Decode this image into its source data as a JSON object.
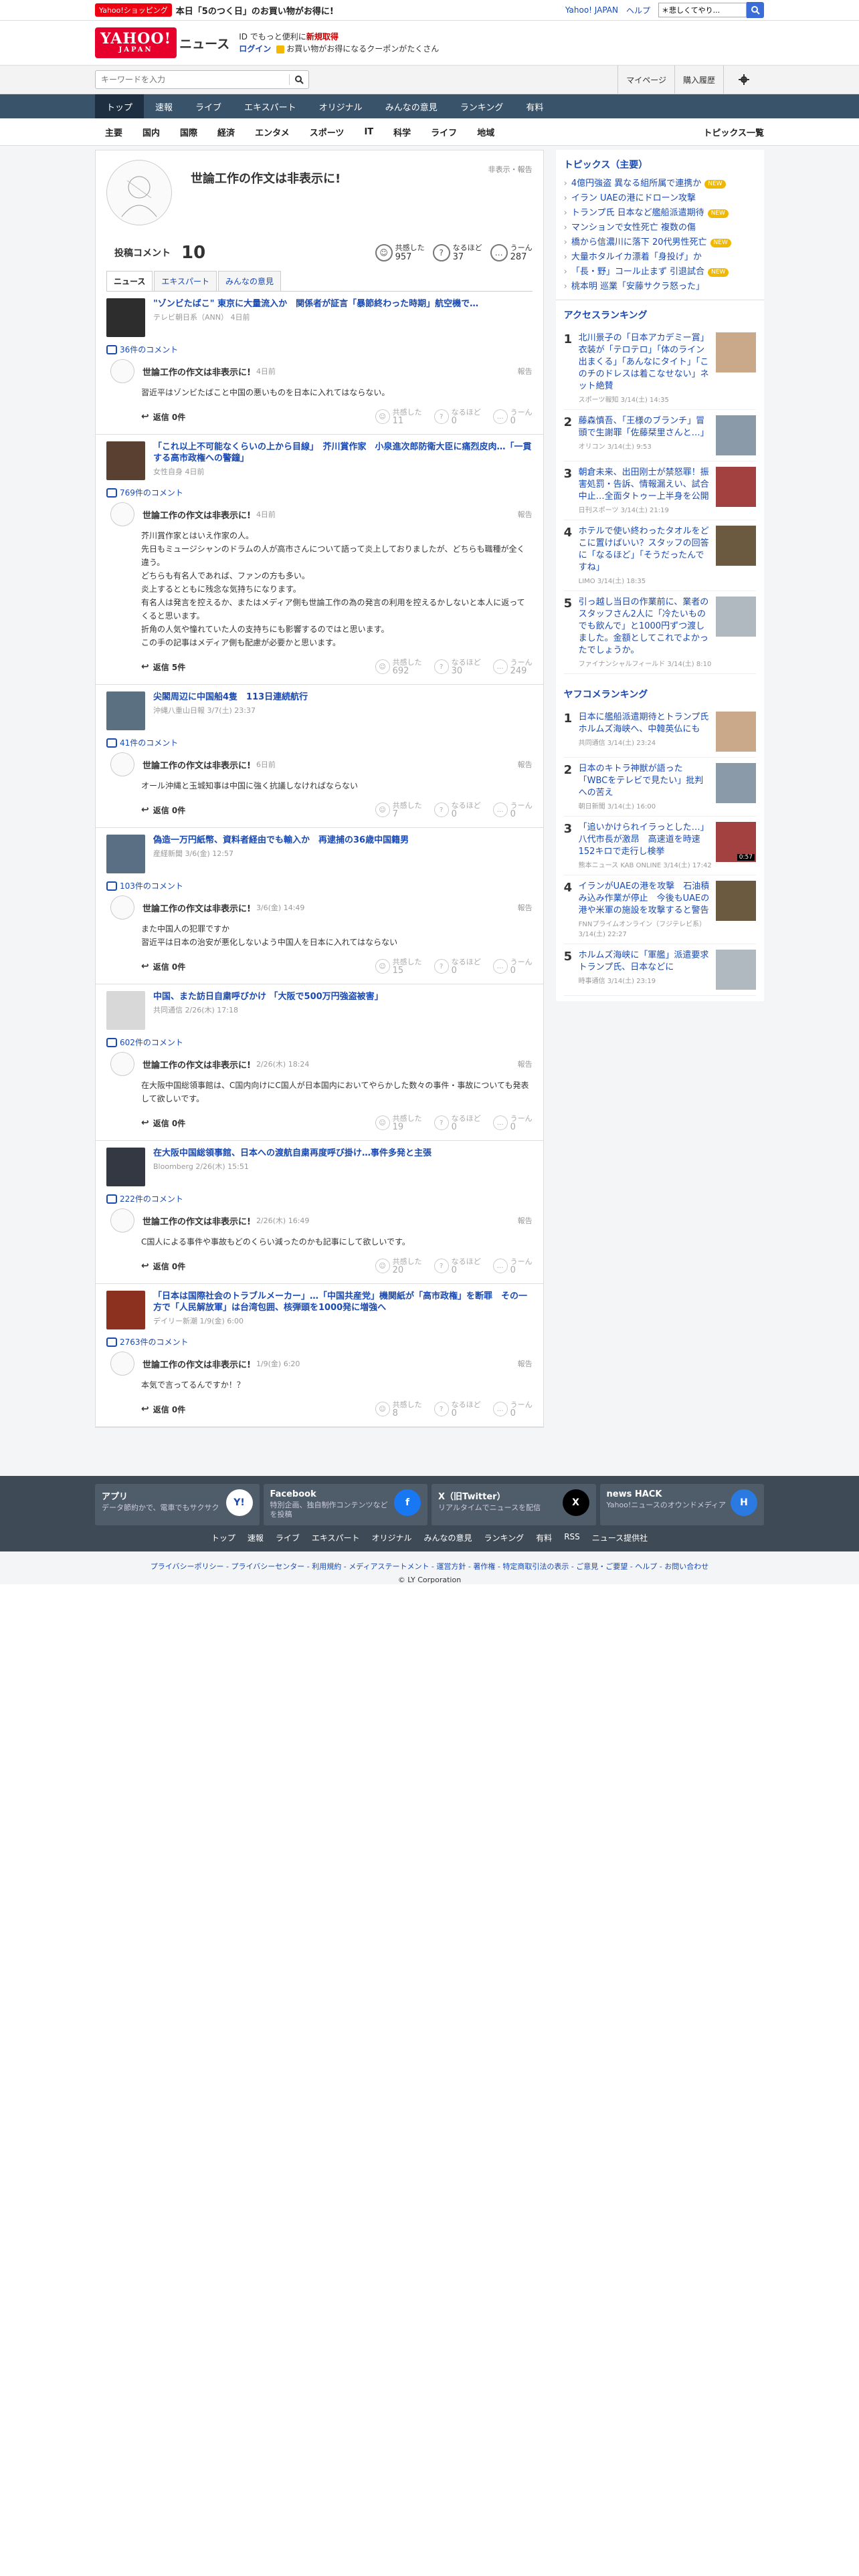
{
  "topstrip": {
    "shop_badge": "Yahoo!ショッピング",
    "promo": "本日「5のつく日」のお買い物がお得に!",
    "links": [
      "Yahoo! JAPAN",
      "ヘルプ"
    ],
    "websearch_placeholder": "ウェブ検索",
    "websearch_value": "＊悲しくてやり..."
  },
  "header": {
    "logo_main": "YAHOO!",
    "logo_sub": "JAPAN",
    "section": "ニュース",
    "promo_line1_a": "ID でもっと便利に",
    "promo_line1_b": "新規取得",
    "login": "ログイン",
    "promo_line2": "お買い物がお得になるクーポンがたくさん"
  },
  "search": {
    "placeholder": "キーワードを入力",
    "links": [
      "マイページ",
      "購入履歴"
    ]
  },
  "mainnav": [
    "トップ",
    "速報",
    "ライブ",
    "エキスパート",
    "オリジナル",
    "みんなの意見",
    "ランキング",
    "有料"
  ],
  "subnav": [
    "主要",
    "国内",
    "国際",
    "経済",
    "エンタメ",
    "スポーツ",
    "IT",
    "科学",
    "ライフ",
    "地域"
  ],
  "subnav_right": "トピックス一覧",
  "profile": {
    "name": "世論工作の作文は非表示に!",
    "report": "非表示・報告",
    "comments_label": "投稿コメント",
    "comments_count": "10",
    "reactions": [
      {
        "label": "共感した",
        "value": "957",
        "icon": "smile-icon"
      },
      {
        "label": "なるほど",
        "value": "37",
        "icon": "question-icon"
      },
      {
        "label": "うーん",
        "value": "287",
        "icon": "hmm-icon"
      }
    ]
  },
  "tabs": [
    "ニュース",
    "エキスパート",
    "みんなの意見"
  ],
  "common": {
    "reply": "返信 0件",
    "report": "報告",
    "vote_labels": [
      "共感した",
      "なるほど",
      "うーん"
    ]
  },
  "comments": [
    {
      "article_title": "\"ゾンビたばこ\" 東京に大量流入か　関係者が証言「暴節終わった時期」航空機で…",
      "article_source": "テレビ朝日系（ANN） 4日前",
      "comment_count": "36件のコメント",
      "name": "世論工作の作文は非表示に!",
      "date": "4日前",
      "text": "習近平はゾンビたばこと中国の悪いものを日本に入れてはならない。",
      "reply": "返信 0件",
      "votes": [
        "11",
        "0",
        "0"
      ]
    },
    {
      "article_title": "「これ以上不可能なくらいの上から目線」　芥川賞作家　小泉進次郎防衛大臣に痛烈皮肉…「一貫する高市政権への警鐘」",
      "article_source": "女性自身 4日前",
      "comment_count": "769件のコメント",
      "name": "世論工作の作文は非表示に!",
      "date": "4日前",
      "text": "芥川賞作家とはいえ作家の人。\n先日もミュージシャンのドラムの人が高市さんについて語って炎上しておりましたが、どちらも職種が全く違う。\nどちらも有名人であれば、ファンの方も多い。\n炎上するとともに残念な気持ちになります。\n有名人は発言を控えるか、またはメディア側も世論工作の為の発言の利用を控えるかしないと本人に返ってくると思います。\n折角の人気や憧れていた人の支持ちにも影響するのではと思います。\nこの手の記事はメディア側も配慮が必要かと思います。",
      "reply": "返信 5件",
      "votes": [
        "692",
        "30",
        "249"
      ]
    },
    {
      "article_title": "尖閣周辺に中国船4隻　113日連続航行",
      "article_source": "沖縄八重山日報 3/7(土) 23:37",
      "comment_count": "41件のコメント",
      "name": "世論工作の作文は非表示に!",
      "date": "6日前",
      "text": "オール沖縄と玉城知事は中国に強く抗議しなければならない",
      "reply": "返信 0件",
      "votes": [
        "7",
        "0",
        "0"
      ]
    },
    {
      "article_title": "偽造一万円紙幣、資料者経由でも輸入か　再逮捕の36歳中国籍男",
      "article_source": "産経新聞 3/6(金) 12:57",
      "comment_count": "103件のコメント",
      "name": "世論工作の作文は非表示に!",
      "date": "3/6(金) 14:49",
      "text": "また中国人の犯罪ですか\n習近平は日本の治安が悪化しないよう中国人を日本に入れてはならない",
      "reply": "返信 0件",
      "votes": [
        "15",
        "0",
        "0"
      ]
    },
    {
      "article_title": "中国、また訪日自粛呼びかけ 「大阪で500万円強盗被害」",
      "article_source": "共同通信 2/26(木) 17:18",
      "comment_count": "602件のコメント",
      "name": "世論工作の作文は非表示に!",
      "date": "2/26(木) 18:24",
      "text": "在大阪中国総領事館は、C国内向けにC国人が日本国内においてやらかした数々の事件・事故についても発表して欲しいです。",
      "reply": "返信 0件",
      "votes": [
        "19",
        "0",
        "0"
      ]
    },
    {
      "article_title": "在大阪中国総領事館、日本への渡航自粛再度呼び掛け…事件多発と主張",
      "article_source": "Bloomberg 2/26(木) 15:51",
      "comment_count": "222件のコメント",
      "name": "世論工作の作文は非表示に!",
      "date": "2/26(木) 16:49",
      "text": "C国人による事件や事故もどのくらい減ったのかも記事にして欲しいです。",
      "reply": "返信 0件",
      "votes": [
        "20",
        "0",
        "0"
      ]
    },
    {
      "article_title": "「日本は国際社会のトラブルメーカー」…「中国共産党」機関紙が「高市政権」を断罪　その一方で「人民解放軍」は台湾包囲、核弾頭を1000発に増強へ",
      "article_source": "デイリー新潮 1/9(金) 6:00",
      "comment_count": "2763件のコメント",
      "name": "世論工作の作文は非表示に!",
      "date": "1/9(金) 6:20",
      "text": "本気で言ってるんですか！？",
      "reply": "返信 0件",
      "votes": [
        "8",
        "0",
        "0"
      ]
    }
  ],
  "sidebar": {
    "topics_title": "トピックス（主要）",
    "topics": [
      {
        "text": "4億円強盗 異なる組所属で連携か",
        "new": true
      },
      {
        "text": "イラン UAEの港にドローン攻撃",
        "new": false
      },
      {
        "text": "トランプ氏 日本など艦船派遣期待",
        "new": true
      },
      {
        "text": "マンションで女性死亡 複数の傷",
        "new": false
      },
      {
        "text": "橋から信濃川に落下 20代男性死亡",
        "new": true
      },
      {
        "text": "大量ホタルイカ漂着「身投げ」か",
        "new": false
      },
      {
        "text": "「長・野」コール止まず 引退試合",
        "new": true
      },
      {
        "text": "桃本明 巡業「安藤サクラ怒った」",
        "new": false
      }
    ],
    "new_label": "NEW",
    "access_title": "アクセスランキング",
    "access": [
      {
        "n": "1",
        "title": "北川景子の「日本アカデミー賞」衣装が「テロテロ」「体のライン出まくる」「あんなにタイト」「このチのドレスは着こなせない」ネット絶賛",
        "src": "スポーツ報知 3/14(土) 14:35",
        "video": ""
      },
      {
        "n": "2",
        "title": "藤森慎吾、「王様のブランチ」冒頭で生謝罪「佐藤栞里さんと…」",
        "src": "オリコン 3/14(土) 9:53",
        "video": ""
      },
      {
        "n": "3",
        "title": "朝倉未来、出田刚士が禁怒罪！振害処罰・告訴、情報漏えい、試合中止…全面タトゥー上半身を公開",
        "src": "日刊スポーツ 3/14(土) 21:19",
        "video": ""
      },
      {
        "n": "4",
        "title": "ホテルで使い終わったタオルをどこに置けばいい？スタッフの回答に「なるほど」「そうだったんですね」",
        "src": "LIMO 3/14(土) 18:35",
        "video": ""
      },
      {
        "n": "5",
        "title": "引っ越し当日の作業前に、業者のスタッフさん2人に「冷たいものでも飲んで」と1000円ずつ渡しました。金額としてこれでよかったでしょうか。",
        "src": "ファイナンシャルフィールド 3/14(土) 8:10",
        "video": ""
      }
    ],
    "yfc_title": "ヤフコメランキング",
    "yfc": [
      {
        "n": "1",
        "title": "日本に艦船派遣期待とトランプ氏 ホルムズ海峡へ、中韓英仏にも",
        "src": "共同通信 3/14(土) 23:24",
        "video": ""
      },
      {
        "n": "2",
        "title": "日本のキトラ神獣が語った「WBCをテレビで見たい」批判への苦え",
        "src": "朝日新聞 3/14(土) 16:00",
        "video": ""
      },
      {
        "n": "3",
        "title": "「追いかけられイラっとした…」八代市長が激昂　高速道を時速152キロで走行し検挙",
        "src": "熊本ニュース KAB ONLINE 3/14(土) 17:42",
        "video": "0:57"
      },
      {
        "n": "4",
        "title": "イランがUAEの港を攻撃　石油積み込み作業が停止　今後もUAEの港や米軍の施設を攻撃すると警告",
        "src": "FNNプライムオンライン（フジテレビ系） 3/14(土) 22:27",
        "video": ""
      },
      {
        "n": "5",
        "title": "ホルムズ海峡に「軍艦」派遣要求　トランプ氏、日本などに",
        "src": "時事通信 3/14(土) 23:19",
        "video": ""
      }
    ]
  },
  "apps": [
    {
      "name": "アプリ",
      "desc": "データ節約かで、電車でもサクサク",
      "icon": "app-icon"
    },
    {
      "name": "Facebook",
      "desc": "特別企画、独自制作コンテンツなどを投稿",
      "icon": "facebook-icon"
    },
    {
      "name": "X（旧Twitter）",
      "desc": "リアルタイムでニュースを配信",
      "icon": "x-icon"
    },
    {
      "name": "news HACK",
      "desc": "Yahoo!ニュースのオウンドメディア",
      "icon": "newshack-icon"
    }
  ],
  "footer_links": [
    "トップ",
    "速報",
    "ライブ",
    "エキスパート",
    "オリジナル",
    "みんなの意見",
    "ランキング",
    "有料",
    "RSS",
    "ニュース提供社"
  ],
  "legal": "プライバシーポリシー - プライバシーセンター - 利用規約 - メディアステートメント - 運営方針 - 著作権 - 特定商取引法の表示 - ご意見・ご要望 - ヘルプ - お問い合わせ",
  "copyright": "© LY Corporation"
}
